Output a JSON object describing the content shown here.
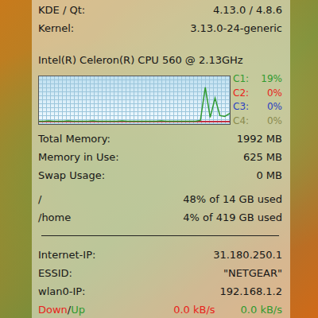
{
  "system": [
    {
      "label": "KDE / Qt:",
      "value": "4.13.0 / 4.8.6"
    },
    {
      "label": "Kernel:",
      "value": "3.13.0-24-generic"
    }
  ],
  "cpu": {
    "name": "Intel(R) Celeron(R) CPU 560 @ 2.13GHz",
    "cores": [
      {
        "label": "C1:",
        "reading": "19%",
        "color": "#2f9a2f",
        "values": [
          1,
          1,
          2,
          1,
          1,
          1,
          2,
          1,
          1,
          1,
          1,
          2,
          1,
          1,
          1,
          1,
          1,
          2,
          1,
          1,
          1,
          1,
          1,
          1,
          1,
          2,
          1,
          1,
          1,
          1,
          1,
          1,
          1,
          3,
          80,
          10,
          55,
          14,
          12,
          19
        ]
      },
      {
        "label": "C2:",
        "reading": "0%",
        "color": "#e8231c",
        "values": [
          0,
          0,
          0,
          0,
          0,
          0,
          0,
          0,
          0,
          0,
          0,
          0,
          0,
          0,
          0,
          0,
          0,
          0,
          0,
          0,
          0,
          0,
          0,
          0,
          0,
          0,
          0,
          0,
          0,
          0,
          0,
          0,
          0,
          0,
          0,
          0,
          0,
          0,
          0,
          0
        ]
      },
      {
        "label": "C3:",
        "reading": "0%",
        "color": "#2a3fc0",
        "values": [
          0,
          0,
          0,
          0,
          0,
          0,
          0,
          0,
          0,
          0,
          0,
          0,
          0,
          0,
          0,
          0,
          0,
          0,
          0,
          0,
          0,
          0,
          0,
          0,
          0,
          0,
          0,
          0,
          0,
          0,
          0,
          0,
          0,
          0,
          0,
          0,
          0,
          0,
          0,
          0
        ]
      },
      {
        "label": "C4:",
        "reading": "0%",
        "color": "#8a8a4e",
        "values": [
          0,
          0,
          0,
          0,
          0,
          0,
          0,
          0,
          0,
          0,
          0,
          0,
          0,
          0,
          0,
          0,
          0,
          0,
          0,
          0,
          0,
          0,
          0,
          0,
          0,
          0,
          0,
          0,
          0,
          0,
          0,
          0,
          0,
          0,
          0,
          0,
          0,
          0,
          0,
          0
        ]
      }
    ]
  },
  "memory": [
    {
      "label": "Total Memory:",
      "value": "1992 MB"
    },
    {
      "label": "Memory in Use:",
      "value": "625 MB"
    },
    {
      "label": "Swap Usage:",
      "value": "0 MB"
    }
  ],
  "disks": [
    {
      "mount": "/",
      "usage": "48% of 14 GB used"
    },
    {
      "mount": "/home",
      "usage": "4% of 419 GB used"
    }
  ],
  "network": [
    {
      "label": "Internet-IP:",
      "value": "31.180.250.1"
    },
    {
      "label": "ESSID:",
      "value": "\"NETGEAR\""
    },
    {
      "label": "wlan0-IP:",
      "value": "192.168.1.2"
    }
  ],
  "traffic": {
    "separator": "/",
    "rates": [
      {
        "label": "Down",
        "reading": "0.0 kB/s",
        "color": "#e8231c"
      },
      {
        "label": "Up",
        "reading": "0.0 kB/s",
        "color": "#2f9a2f"
      }
    ]
  }
}
